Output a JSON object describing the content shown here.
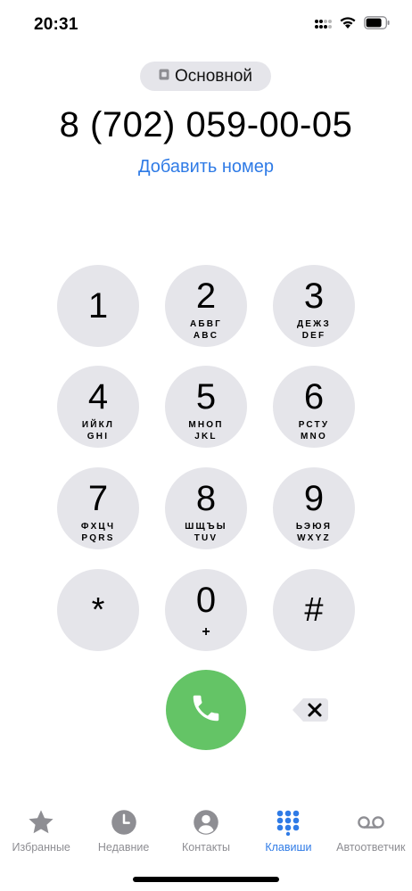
{
  "status_bar": {
    "time": "20:31",
    "icons": [
      "cellular-signal-icon",
      "wifi-icon",
      "battery-icon"
    ]
  },
  "sim": {
    "icon": "sim-card-icon",
    "label": "Основной"
  },
  "dialed_number": "8 (702) 059-00-05",
  "add_number_label": "Добавить номер",
  "keypad": {
    "k1": {
      "digit": "1"
    },
    "k2": {
      "digit": "2",
      "letters_ru": "АБВГ",
      "letters_en": "ABC"
    },
    "k3": {
      "digit": "3",
      "letters_ru": "ДЕЖЗ",
      "letters_en": "DEF"
    },
    "k4": {
      "digit": "4",
      "letters_ru": "ИЙКЛ",
      "letters_en": "GHI"
    },
    "k5": {
      "digit": "5",
      "letters_ru": "МНОП",
      "letters_en": "JKL"
    },
    "k6": {
      "digit": "6",
      "letters_ru": "РСТУ",
      "letters_en": "MNO"
    },
    "k7": {
      "digit": "7",
      "letters_ru": "ФХЦЧ",
      "letters_en": "PQRS"
    },
    "k8": {
      "digit": "8",
      "letters_ru": "ШЩЪЫ",
      "letters_en": "TUV"
    },
    "k9": {
      "digit": "9",
      "letters_ru": "ЬЭЮЯ",
      "letters_en": "WXYZ"
    },
    "kstar": {
      "digit": "*"
    },
    "k0": {
      "digit": "0",
      "plus": "+"
    },
    "khash": {
      "digit": "#"
    }
  },
  "call_button_icon": "phone-icon",
  "delete_button_icon": "delete-backspace-icon",
  "tabs": [
    {
      "label": "Избранные",
      "icon": "star-icon",
      "active": false
    },
    {
      "label": "Недавние",
      "icon": "clock-icon",
      "active": false
    },
    {
      "label": "Контакты",
      "icon": "person-icon",
      "active": false
    },
    {
      "label": "Клавиши",
      "icon": "keypad-icon",
      "active": true
    },
    {
      "label": "Автоответчик",
      "icon": "voicemail-icon",
      "active": false
    }
  ],
  "colors": {
    "accent": "#2f7be6",
    "key_background": "#e5e5ea",
    "call_green": "#64c466",
    "inactive_tab": "#8e8e93"
  }
}
